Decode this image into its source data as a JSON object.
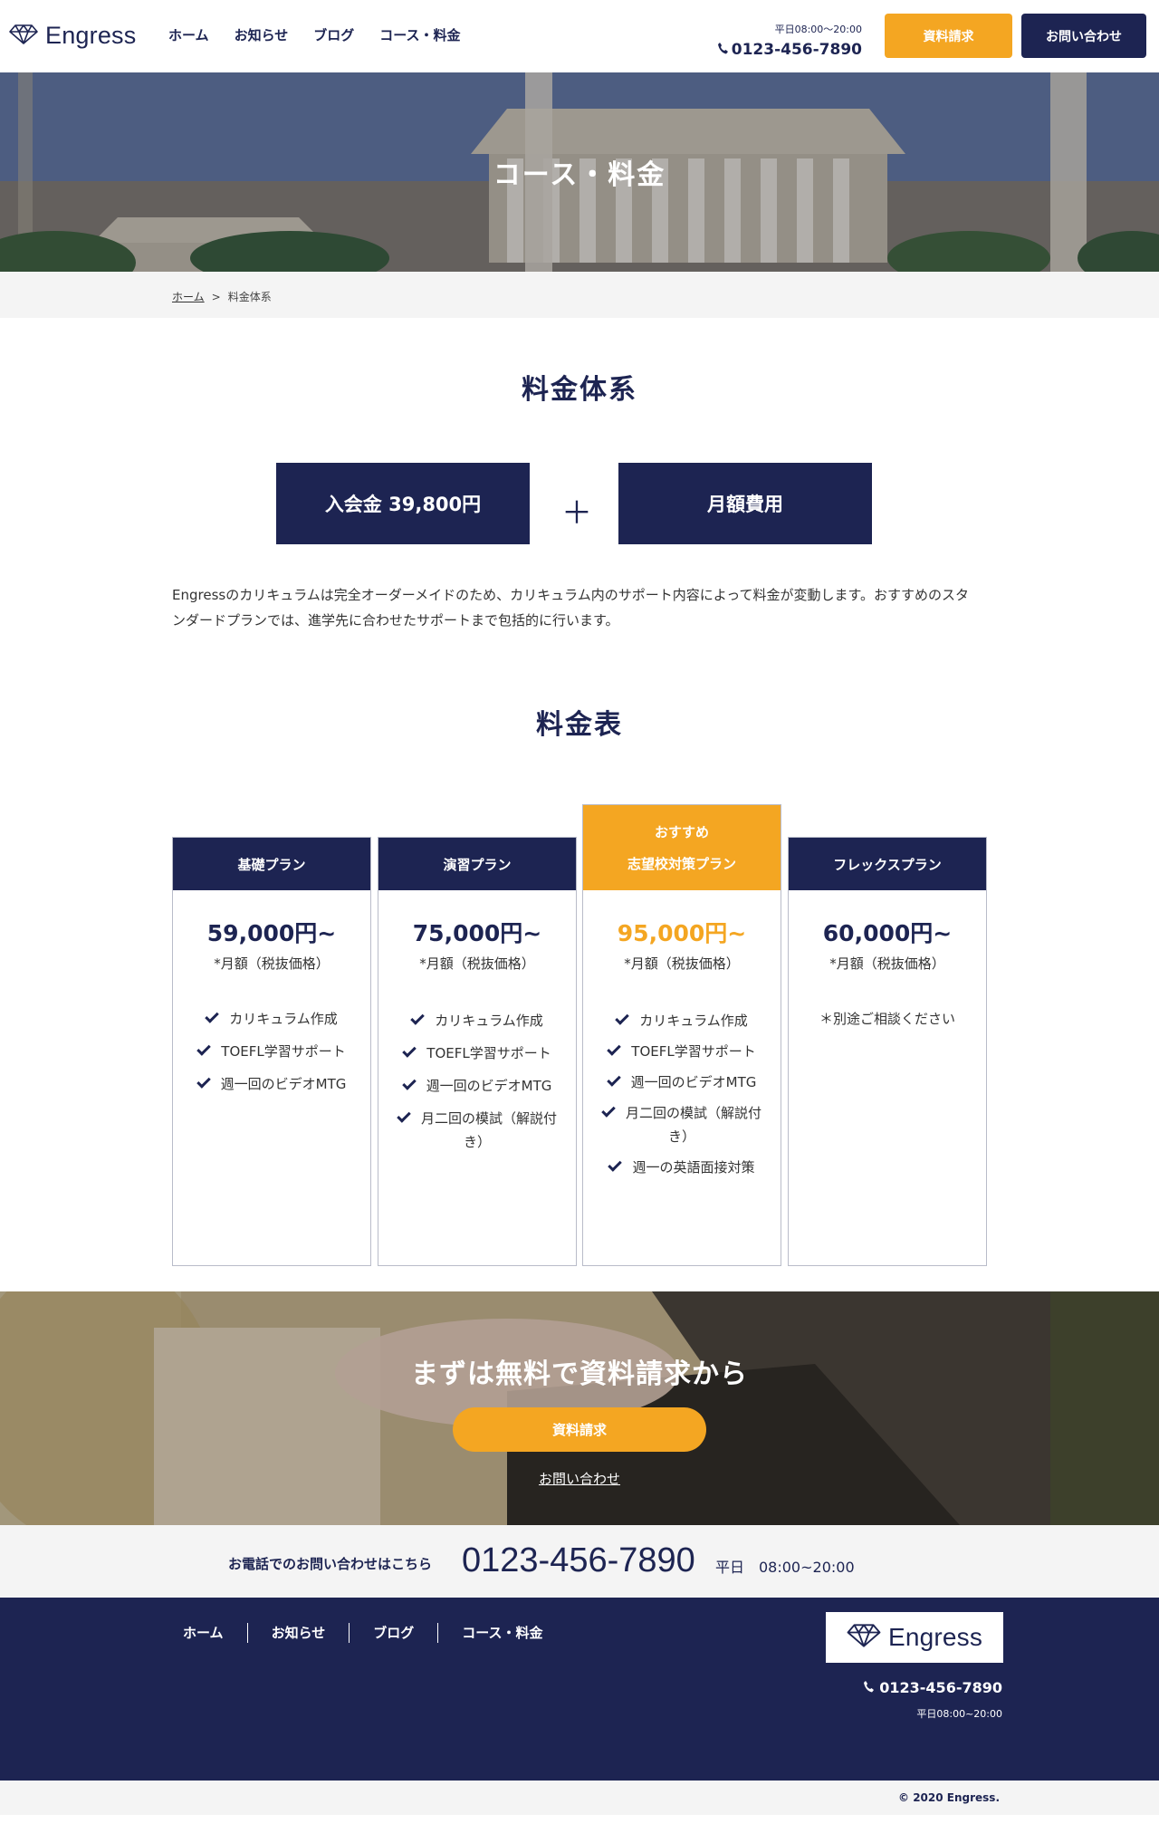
{
  "brand": {
    "name": "Engress",
    "logo_icon": "diamond-icon",
    "navy": "#1d2452",
    "accent": "#f4a622"
  },
  "header": {
    "nav": [
      "ホーム",
      "お知らせ",
      "ブログ",
      "コース・料金"
    ],
    "hours": "平日08:00〜20:00",
    "phone": "0123-456-7890",
    "request_label": "資料請求",
    "contact_label": "お問い合わせ"
  },
  "hero": {
    "title": "コース・料金"
  },
  "breadcrumb": {
    "home": "ホーム",
    "separator": ">",
    "current": "料金体系"
  },
  "pricing_system": {
    "title": "料金体系",
    "entry_fee": "入会金 39,800円",
    "plus": "＋",
    "monthly": "月額費用",
    "description": "Engressのカリキュラムは完全オーダーメイドのため、カリキュラム内のサポート内容によって料金が変動します。おすすめのスタンダードプランでは、進学先に合わせたサポートまで包括的に行います。"
  },
  "price_table": {
    "title": "料金表",
    "plans": [
      {
        "name": "基礎プラン",
        "badge": "",
        "price": "59,000円~",
        "note": "*月額（税抜価格）",
        "features": [
          "カリキュラム作成",
          "TOEFL学習サポート",
          "週一回のビデオMTG"
        ]
      },
      {
        "name": "演習プラン",
        "badge": "",
        "price": "75,000円~",
        "note": "*月額（税抜価格）",
        "features": [
          "カリキュラム作成",
          "TOEFL学習サポート",
          "週一回のビデオMTG",
          "月二回の模試（解説付き）"
        ]
      },
      {
        "name": "志望校対策プラン",
        "badge": "おすすめ",
        "price": "95,000円~",
        "note": "*月額（税抜価格）",
        "features": [
          "カリキュラム作成",
          "TOEFL学習サポート",
          "週一回のビデオMTG",
          "月二回の模試（解説付き）",
          "週一の英語面接対策"
        ]
      },
      {
        "name": "フレックスプラン",
        "badge": "",
        "price": "60,000円~",
        "note": "*月額（税抜価格）",
        "features": [],
        "extra": "＊別途ご相談ください"
      }
    ]
  },
  "cta": {
    "title": "まずは無料で資料請求から",
    "button": "資料請求",
    "link": "お問い合わせ"
  },
  "phone_band": {
    "label": "お電話でのお問い合わせはこちら",
    "number": "0123-456-7890",
    "hours": "平日　08:00~20:00"
  },
  "footer": {
    "nav": [
      "ホーム",
      "お知らせ",
      "ブログ",
      "コース・料金"
    ],
    "phone": "0123-456-7890",
    "hours": "平日08:00~20:00",
    "copyright": "© 2020 Engress."
  }
}
